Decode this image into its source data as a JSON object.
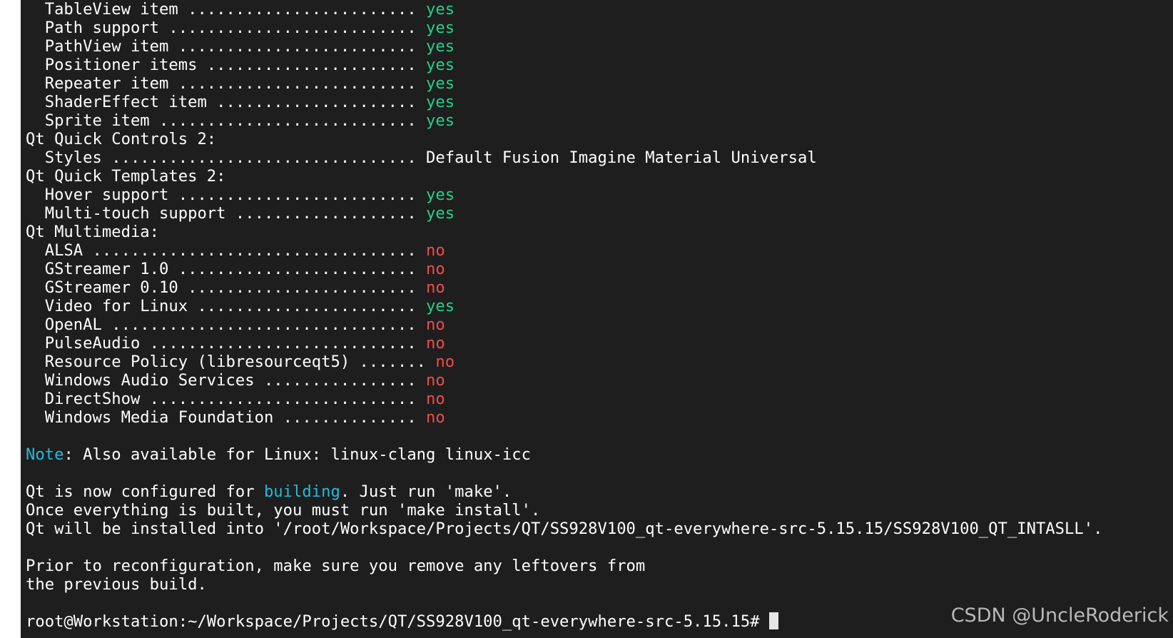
{
  "terminal": {
    "lines": [
      {
        "text": "  TableView item ........................ ",
        "value": "yes",
        "status": "yes"
      },
      {
        "text": "  Path support .......................... ",
        "value": "yes",
        "status": "yes"
      },
      {
        "text": "  PathView item ......................... ",
        "value": "yes",
        "status": "yes"
      },
      {
        "text": "  Positioner items ...................... ",
        "value": "yes",
        "status": "yes"
      },
      {
        "text": "  Repeater item ......................... ",
        "value": "yes",
        "status": "yes"
      },
      {
        "text": "  ShaderEffect item ..................... ",
        "value": "yes",
        "status": "yes"
      },
      {
        "text": "  Sprite item ........................... ",
        "value": "yes",
        "status": "yes"
      },
      {
        "text": "Qt Quick Controls 2:"
      },
      {
        "text": "  Styles ................................ Default Fusion Imagine Material Universal"
      },
      {
        "text": "Qt Quick Templates 2:"
      },
      {
        "text": "  Hover support ......................... ",
        "value": "yes",
        "status": "yes"
      },
      {
        "text": "  Multi-touch support ................... ",
        "value": "yes",
        "status": "yes"
      },
      {
        "text": "Qt Multimedia:"
      },
      {
        "text": "  ALSA .................................. ",
        "value": "no",
        "status": "no"
      },
      {
        "text": "  GStreamer 1.0 ......................... ",
        "value": "no",
        "status": "no"
      },
      {
        "text": "  GStreamer 0.10 ........................ ",
        "value": "no",
        "status": "no"
      },
      {
        "text": "  Video for Linux ....................... ",
        "value": "yes",
        "status": "yes"
      },
      {
        "text": "  OpenAL ................................ ",
        "value": "no",
        "status": "no"
      },
      {
        "text": "  PulseAudio ............................ ",
        "value": "no",
        "status": "no"
      },
      {
        "text": "  Resource Policy (libresourceqt5) ....... ",
        "value": "no",
        "status": "no"
      },
      {
        "text": "  Windows Audio Services ................ ",
        "value": "no",
        "status": "no"
      },
      {
        "text": "  DirectShow ............................ ",
        "value": "no",
        "status": "no"
      },
      {
        "text": "  Windows Media Foundation .............. ",
        "value": "no",
        "status": "no"
      },
      {
        "text": ""
      },
      {
        "pre": "",
        "highlight": "Note",
        "text": ": Also available for Linux: linux-clang linux-icc"
      },
      {
        "text": ""
      },
      {
        "pre": "Qt is now configured for ",
        "highlight": "building",
        "text": ". Just run 'make'."
      },
      {
        "text": "Once everything is built, you must run 'make install'."
      },
      {
        "text": "Qt will be installed into '/root/Workspace/Projects/QT/SS928V100_qt-everywhere-src-5.15.15/SS928V100_QT_INTASLL'."
      },
      {
        "text": ""
      },
      {
        "text": "Prior to reconfiguration, make sure you remove any leftovers from"
      },
      {
        "text": "the previous build."
      },
      {
        "text": ""
      },
      {
        "text": "root@Workstation:~/Workspace/Projects/QT/SS928V100_qt-everywhere-src-5.15.15# ",
        "cursor": true
      }
    ],
    "colors": {
      "background": "#1e1e1e",
      "foreground": "#ffffff",
      "yes": "#23d18b",
      "no": "#f14c4c",
      "highlight": "#29b8db"
    }
  },
  "watermark": "CSDN @UncleRoderick"
}
